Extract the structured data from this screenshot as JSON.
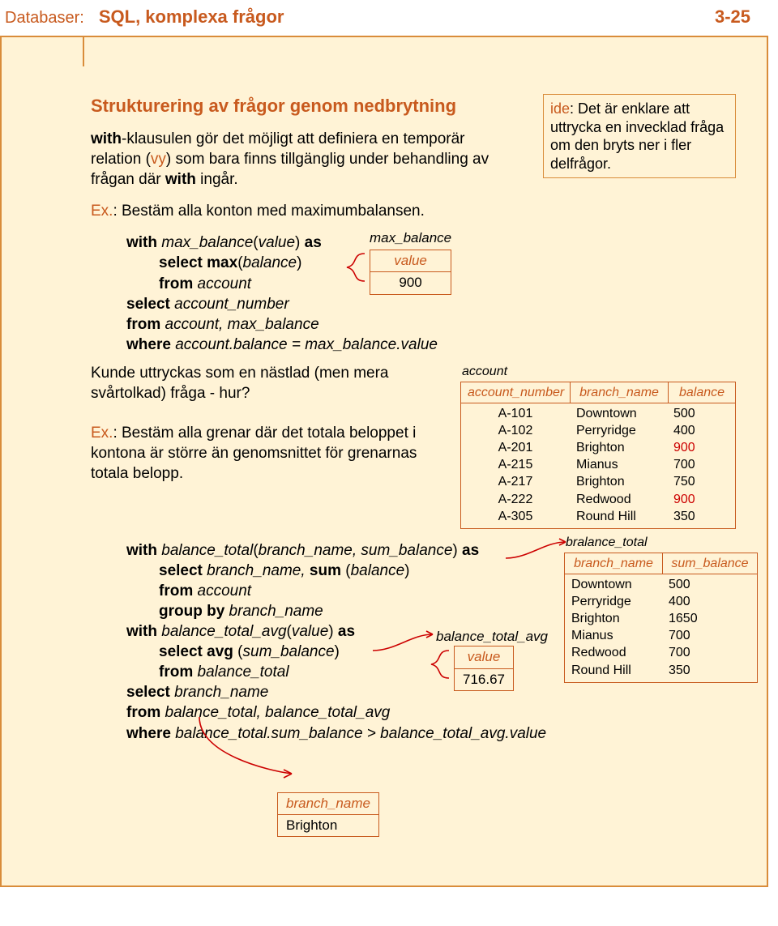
{
  "header": {
    "category": "Databaser:",
    "topic": "SQL, komplexa frågor",
    "pagenum": "3-25"
  },
  "section_title": "Strukturering av frågor genom nedbrytning",
  "intro": {
    "l1a": "with",
    "l1b": "-klausulen gör det möjligt att definiera en temporär relation (",
    "l1c": "vy",
    "l1d": ") som bara finns tillgänglig under behandling av frågan där ",
    "l1e": "with",
    "l1f": " ingår."
  },
  "idea": {
    "label": "ide",
    "text": ": Det är enklare att uttrycka en invecklad fråga om den bryts ner i fler delfrågor."
  },
  "ex1": {
    "label": "Ex.",
    "text": ": Bestäm alla konton med maximumbalansen."
  },
  "sql1": {
    "l1a": "with",
    "l1b": " max_balance",
    "l1c": "(",
    "l1d": "value",
    "l1e": ") ",
    "l1f": "as",
    "l2a": "select max",
    "l2b": "(",
    "l2c": "balance",
    "l2d": ")",
    "l3a": "from",
    "l3b": " account",
    "l4a": "select",
    "l4b": " account_number",
    "l5a": "from",
    "l5b": " account, max_balance",
    "l6a": "where",
    "l6b": " account.balance = max_balance.value"
  },
  "max_balance": {
    "caption": "max_balance",
    "header": "value",
    "value": "900"
  },
  "nested_q": "Kunde uttryckas som en nästlad (men mera svårtolkad) fråga - hur?",
  "account": {
    "caption": "account",
    "h1": "account_number",
    "h2": "branch_name",
    "h3": "balance",
    "rows": [
      {
        "n": "A-101",
        "b": "Downtown",
        "v": "500",
        "red": false
      },
      {
        "n": "A-102",
        "b": "Perryridge",
        "v": "400",
        "red": false
      },
      {
        "n": "A-201",
        "b": "Brighton",
        "v": "900",
        "red": true
      },
      {
        "n": "A-215",
        "b": "Mianus",
        "v": "700",
        "red": false
      },
      {
        "n": "A-217",
        "b": "Brighton",
        "v": "750",
        "red": false
      },
      {
        "n": "A-222",
        "b": "Redwood",
        "v": "900",
        "red": true
      },
      {
        "n": "A-305",
        "b": "Round Hill",
        "v": "350",
        "red": false
      }
    ]
  },
  "ex2": {
    "label": "Ex.",
    "text": ": Bestäm alla grenar där det totala beloppet i kontona är större än genomsnittet för grenarnas totala belopp."
  },
  "sql2": {
    "l1a": "with",
    "l1b": " balance_total",
    "l1c": "(",
    "l1d": "branch_name, sum_balance",
    "l1e": ") ",
    "l1f": "as",
    "l2a": "select",
    "l2b": " branch_name, ",
    "l2c": "sum ",
    "l2d": "(",
    "l2e": "balance",
    "l2f": ")",
    "l3a": "from",
    "l3b": " account",
    "l4a": "group by",
    "l4b": " branch_name",
    "l5a": "with",
    "l5b": " balance_total_avg",
    "l5c": "(",
    "l5d": "value",
    "l5e": ") ",
    "l5f": "as",
    "l6a": "select avg ",
    "l6b": "(",
    "l6c": "sum_balance",
    "l6d": ")",
    "l7a": "from",
    "l7b": " balance_total",
    "l8a": "select",
    "l8b": " branch_name",
    "l9a": "from",
    "l9b": " balance_total, balance_total_avg",
    "l10a": "where",
    "l10b": " balance_total.sum_balance > balance_total_avg.value"
  },
  "bralance": {
    "caption": "bralance_total",
    "h1": "branch_name",
    "h2": "sum_balance",
    "rows": [
      {
        "n": "Downtown",
        "v": "500"
      },
      {
        "n": "Perryridge",
        "v": "400"
      },
      {
        "n": "Brighton",
        "v": "1650"
      },
      {
        "n": "Mianus",
        "v": "700"
      },
      {
        "n": "Redwood",
        "v": "700"
      },
      {
        "n": "Round Hill",
        "v": "350"
      }
    ]
  },
  "bta": {
    "caption": "balance_total_avg",
    "header": "value",
    "value": "716.67"
  },
  "result": {
    "header": "branch_name",
    "value": "Brighton"
  }
}
